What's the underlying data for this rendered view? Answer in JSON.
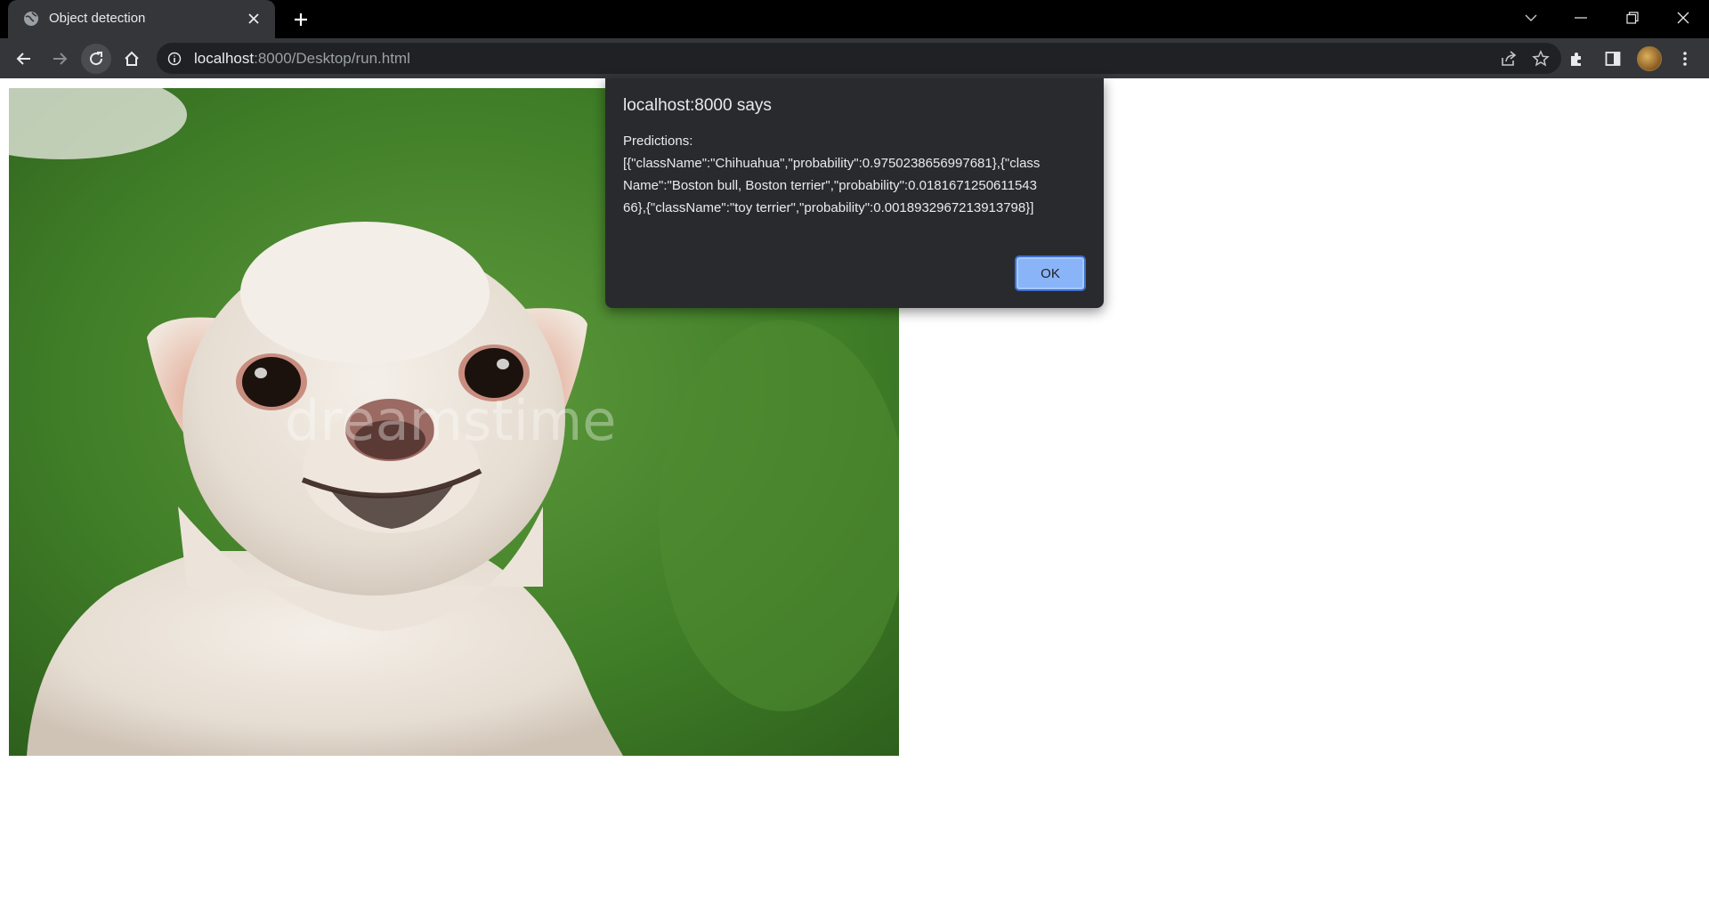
{
  "browser": {
    "tab": {
      "title": "Object detection",
      "favicon": "globe-icon"
    },
    "new_tab_icon": "plus-icon",
    "window_controls": [
      "tab-search-icon",
      "minimize-icon",
      "restore-icon",
      "close-icon"
    ],
    "url": {
      "host": "localhost",
      "rest": ":8000/Desktop/run.html"
    },
    "toolbar_icons": [
      "back-icon",
      "forward-icon",
      "reload-icon",
      "home-icon",
      "extensions-icon",
      "side-panel-icon",
      "menu-icon"
    ]
  },
  "dialog": {
    "title": "localhost:8000 says",
    "message_heading": "Predictions:",
    "message_body": "[{\"className\":\"Chihuahua\",\"probability\":0.9750238656997681},{\"className\":\"Boston bull, Boston terrier\",\"probability\":0.018167125061154366},{\"className\":\"toy terrier\",\"probability\":0.0018932967213913798}]",
    "ok_label": "OK"
  },
  "page": {
    "image_subject": "chihuahua dog photo",
    "watermark": "dreamstime"
  },
  "colors": {
    "tab_strip": "#000000",
    "toolbar": "#35363a",
    "omnibox": "#202124",
    "dialog_bg": "#292a2d",
    "ok_button": "#8ab4f8"
  }
}
